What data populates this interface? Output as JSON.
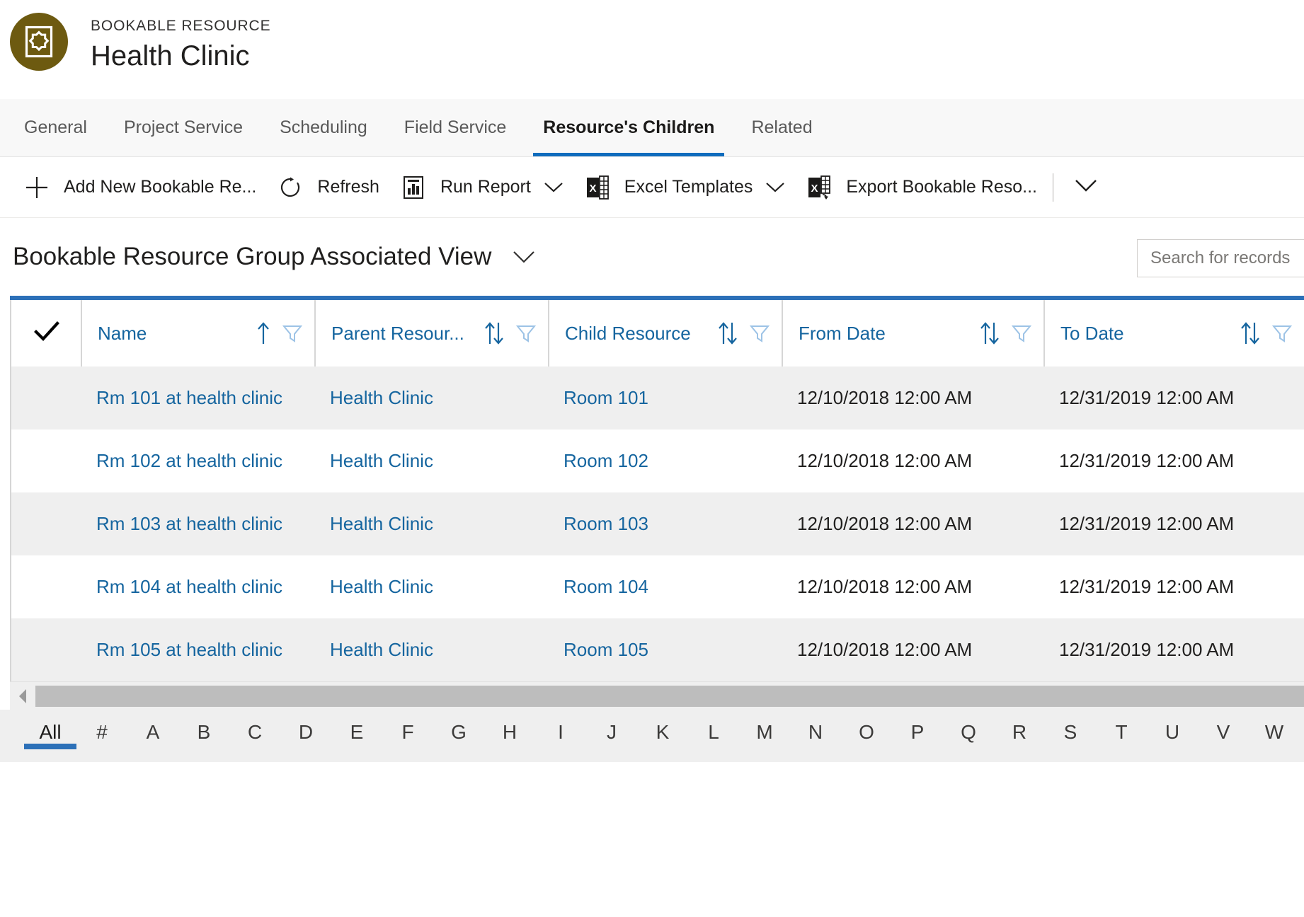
{
  "header": {
    "entity_type": "BOOKABLE RESOURCE",
    "record_title": "Health Clinic",
    "avatar_icon": "bookable-resource-icon",
    "avatar_color": "#6d5a10"
  },
  "tabs": [
    {
      "label": "General",
      "selected": false
    },
    {
      "label": "Project Service",
      "selected": false
    },
    {
      "label": "Scheduling",
      "selected": false
    },
    {
      "label": "Field Service",
      "selected": false
    },
    {
      "label": "Resource's Children",
      "selected": true
    },
    {
      "label": "Related",
      "selected": false
    }
  ],
  "commandbar": {
    "commands": [
      {
        "label": "Add New Bookable Re...",
        "icon": "plus-icon",
        "has_chevron": false,
        "name": "add-new-bookable-resource-group-button"
      },
      {
        "label": "Refresh",
        "icon": "refresh-icon",
        "has_chevron": false,
        "name": "refresh-button"
      },
      {
        "label": "Run Report",
        "icon": "report-icon",
        "has_chevron": true,
        "name": "run-report-button"
      },
      {
        "label": "Excel Templates",
        "icon": "excel-icon",
        "has_chevron": true,
        "name": "excel-templates-button"
      },
      {
        "label": "Export Bookable Reso...",
        "icon": "excel-export-icon",
        "has_chevron": false,
        "name": "export-bookable-resource-button"
      }
    ],
    "overflow_icon": "chevron-down-icon"
  },
  "view": {
    "name": "Bookable Resource Group Associated View",
    "selector_icon": "chevron-down-icon"
  },
  "search": {
    "value": "",
    "placeholder": "Search for records"
  },
  "grid": {
    "accent_color": "#2c70b8",
    "link_color": "#15659f",
    "select_all_icon": "checkmark-icon",
    "columns": [
      {
        "label": "Name",
        "sort_icon": "sort-asc-icon",
        "filter_icon": "filter-icon"
      },
      {
        "label": "Parent Resour...",
        "sort_icon": "sort-icon",
        "filter_icon": "filter-icon"
      },
      {
        "label": "Child Resource",
        "sort_icon": "sort-icon",
        "filter_icon": "filter-icon"
      },
      {
        "label": "From Date",
        "sort_icon": "sort-icon",
        "filter_icon": "filter-icon"
      },
      {
        "label": "To Date",
        "sort_icon": "sort-icon",
        "filter_icon": "filter-icon"
      }
    ],
    "rows": [
      {
        "name": "Rm 101 at health clinic",
        "parent_resource": "Health Clinic",
        "child_resource": "Room 101",
        "from_date": "12/10/2018 12:00 AM",
        "to_date": "12/31/2019 12:00 AM"
      },
      {
        "name": "Rm 102 at health clinic",
        "parent_resource": "Health Clinic",
        "child_resource": "Room 102",
        "from_date": "12/10/2018 12:00 AM",
        "to_date": "12/31/2019 12:00 AM"
      },
      {
        "name": "Rm 103 at health clinic",
        "parent_resource": "Health Clinic",
        "child_resource": "Room 103",
        "from_date": "12/10/2018 12:00 AM",
        "to_date": "12/31/2019 12:00 AM"
      },
      {
        "name": "Rm 104 at health clinic",
        "parent_resource": "Health Clinic",
        "child_resource": "Room 104",
        "from_date": "12/10/2018 12:00 AM",
        "to_date": "12/31/2019 12:00 AM"
      },
      {
        "name": "Rm 105 at health clinic",
        "parent_resource": "Health Clinic",
        "child_resource": "Room 105",
        "from_date": "12/10/2018 12:00 AM",
        "to_date": "12/31/2019 12:00 AM"
      }
    ]
  },
  "scrollbar": {
    "left_arrow_icon": "caret-left-icon"
  },
  "alpha_index": {
    "selected": "All",
    "items": [
      "All",
      "#",
      "A",
      "B",
      "C",
      "D",
      "E",
      "F",
      "G",
      "H",
      "I",
      "J",
      "K",
      "L",
      "M",
      "N",
      "O",
      "P",
      "Q",
      "R",
      "S",
      "T",
      "U",
      "V",
      "W"
    ]
  }
}
